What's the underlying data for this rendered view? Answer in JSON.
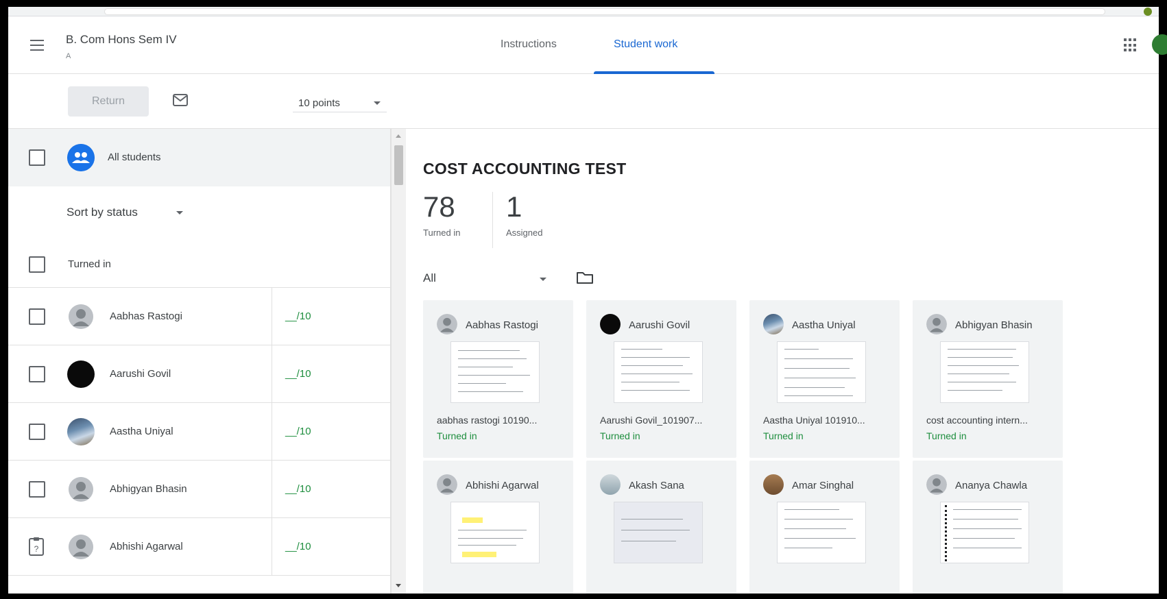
{
  "header": {
    "class_title": "B. Com Hons Sem IV",
    "class_section": "A",
    "tabs": [
      {
        "label": "Instructions",
        "active": false
      },
      {
        "label": "Student work",
        "active": true
      }
    ]
  },
  "toolbar": {
    "return_label": "Return",
    "points_value": "10 points"
  },
  "roster": {
    "all_students_label": "All students",
    "sort_label": "Sort by status",
    "group_header": "Turned in",
    "students": [
      {
        "name": "Aabhas Rastogi",
        "grade": "__/10",
        "avatar": "gray"
      },
      {
        "name": "Aarushi Govil",
        "grade": "__/10",
        "avatar": "black"
      },
      {
        "name": "Aastha Uniyal",
        "grade": "__/10",
        "avatar": "photo"
      },
      {
        "name": "Abhigyan Bhasin",
        "grade": "__/10",
        "avatar": "gray"
      },
      {
        "name": "Abhishi Agarwal",
        "grade": "__/10",
        "avatar": "gray"
      }
    ]
  },
  "main": {
    "assignment_title": "COST ACCOUNTING TEST",
    "stats": [
      {
        "value": "78",
        "label": "Turned in"
      },
      {
        "value": "1",
        "label": "Assigned"
      }
    ],
    "filter_value": "All",
    "cards": [
      {
        "name": "Aabhas Rastogi",
        "file": "aabhas rastogi 10190...",
        "status": "Turned in",
        "avatar": "gray"
      },
      {
        "name": "Aarushi Govil",
        "file": "Aarushi Govil_101907...",
        "status": "Turned in",
        "avatar": "black"
      },
      {
        "name": "Aastha Uniyal",
        "file": "Aastha Uniyal 101910...",
        "status": "Turned in",
        "avatar": "photo"
      },
      {
        "name": "Abhigyan Bhasin",
        "file": "cost accounting intern...",
        "status": "Turned in",
        "avatar": "gray"
      },
      {
        "name": "Abhishi Agarwal",
        "file": "",
        "status": "",
        "avatar": "gray"
      },
      {
        "name": "Akash Sana",
        "file": "",
        "status": "",
        "avatar": "man"
      },
      {
        "name": "Amar Singhal",
        "file": "",
        "status": "",
        "avatar": "amar"
      },
      {
        "name": "Ananya Chawla",
        "file": "",
        "status": "",
        "avatar": "gray"
      }
    ]
  },
  "colors": {
    "accent": "#1967d2",
    "turned_in_green": "#1e8e3e",
    "panel_gray": "#f1f3f4"
  },
  "icons": [
    "menu-icon",
    "mail-icon",
    "apps-grid-icon",
    "group-icon",
    "folder-icon",
    "caret-down-icon",
    "pending-status-icon"
  ]
}
